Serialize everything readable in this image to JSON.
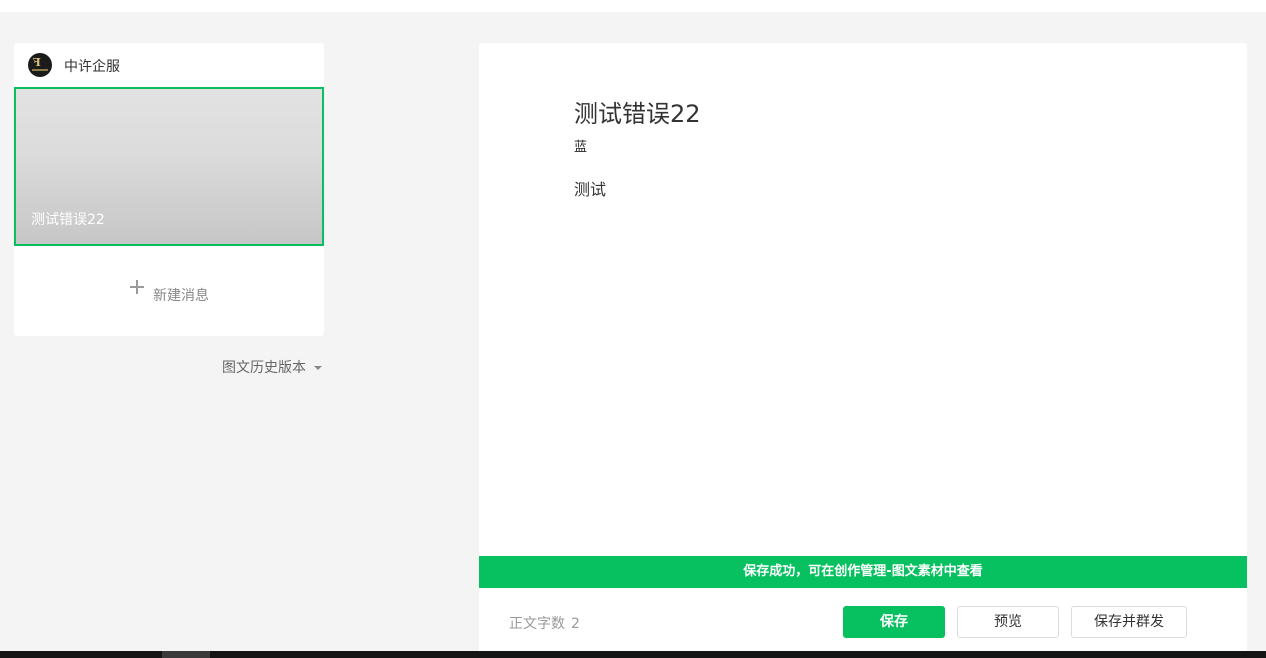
{
  "account": {
    "name": "中许企服",
    "avatar_icon": "brand-logo"
  },
  "article_list": {
    "items": [
      {
        "title": "测试错误22",
        "selected": true
      }
    ],
    "new_message_label": "新建消息"
  },
  "history": {
    "label": "图文历史版本"
  },
  "editor": {
    "title": "测试错误22",
    "author": "蓝",
    "body": "测试"
  },
  "toast": {
    "message": "保存成功，可在创作管理-图文素材中查看",
    "color": "#07c160"
  },
  "footer": {
    "word_count_label": "正文字数",
    "word_count": "2",
    "save_label": "保存",
    "preview_label": "预览",
    "publish_label": "保存并群发"
  },
  "colors": {
    "accent": "#07c160",
    "background": "#f4f4f4"
  }
}
